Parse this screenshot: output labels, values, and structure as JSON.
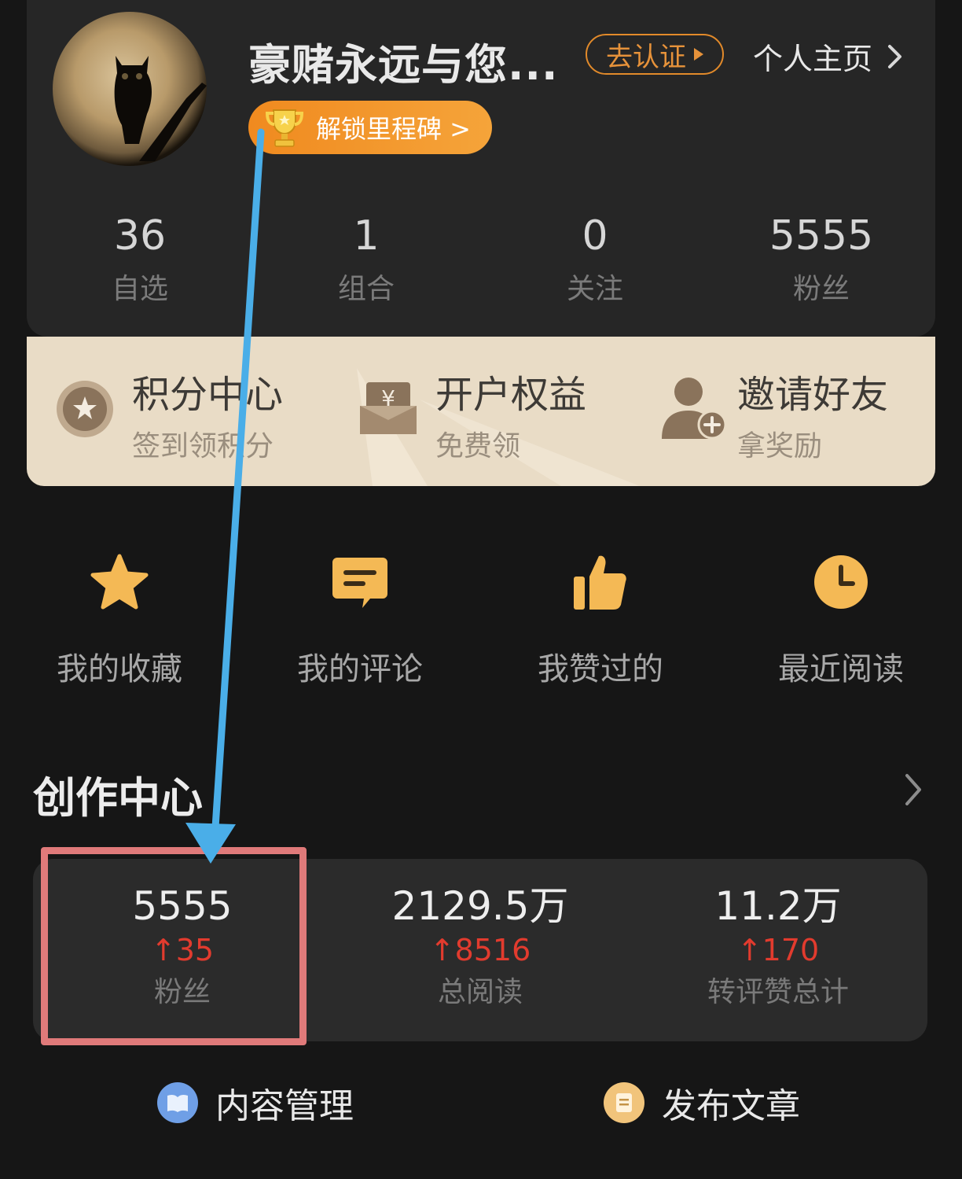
{
  "profile": {
    "username": "豪赌永远与您...",
    "verify_label": "去认证",
    "homepage_label": "个人主页",
    "milestone_label": "解锁里程碑 >",
    "stats": [
      {
        "value": "36",
        "label": "自选"
      },
      {
        "value": "1",
        "label": "组合"
      },
      {
        "value": "0",
        "label": "关注"
      },
      {
        "value": "5555",
        "label": "粉丝"
      }
    ]
  },
  "benefits": [
    {
      "title": "积分中心",
      "subtitle": "签到领积分",
      "icon": "star-coin-icon"
    },
    {
      "title": "开户权益",
      "subtitle": "免费领",
      "icon": "yuan-wallet-icon"
    },
    {
      "title": "邀请好友",
      "subtitle": "拿奖励",
      "icon": "add-person-icon"
    }
  ],
  "quick_actions": [
    {
      "label": "我的收藏",
      "icon": "star-icon"
    },
    {
      "label": "我的评论",
      "icon": "comment-icon"
    },
    {
      "label": "我赞过的",
      "icon": "thumbs-up-icon"
    },
    {
      "label": "最近阅读",
      "icon": "clock-icon"
    }
  ],
  "creation_center": {
    "title": "创作中心",
    "stats": [
      {
        "value": "5555",
        "delta": "35",
        "label": "粉丝"
      },
      {
        "value": "2129.5万",
        "delta": "8516",
        "label": "总阅读"
      },
      {
        "value": "11.2万",
        "delta": "170",
        "label": "转评赞总计"
      }
    ],
    "actions": [
      {
        "label": "内容管理",
        "icon": "book-icon"
      },
      {
        "label": "发布文章",
        "icon": "document-icon"
      }
    ]
  },
  "colors": {
    "accent_orange": "#f08a1f",
    "benefit_bg": "#e9dcc6",
    "increase_red": "#e23b2e",
    "annotation_blue": "#4aaee8",
    "highlight_red": "#e07a7a"
  }
}
